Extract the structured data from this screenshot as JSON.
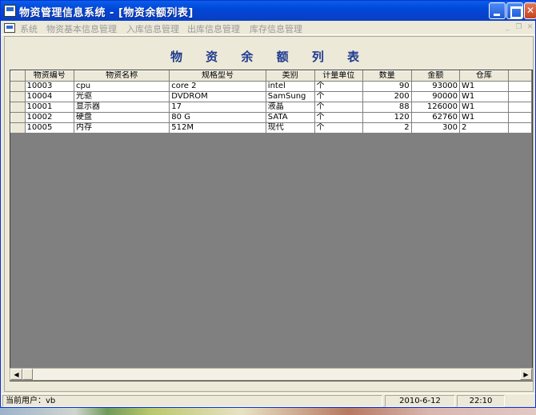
{
  "window": {
    "title": "物资管理信息系统 - [物资余额列表]"
  },
  "menu": {
    "items": [
      "系统",
      "物资基本信息管理",
      "入库信息管理",
      "出库信息管理",
      "库存信息管理"
    ]
  },
  "grid": {
    "title": "物 资 余 额 列 表",
    "columns": [
      "物资编号",
      "物资名称",
      "规格型号",
      "类别",
      "计量单位",
      "数量",
      "金额",
      "仓库"
    ],
    "rows": [
      [
        "10003",
        "cpu",
        "core 2",
        "intel",
        "个",
        "90",
        "93000",
        "W1"
      ],
      [
        "10004",
        "光驱",
        "DVDROM",
        "SamSung",
        "个",
        "200",
        "90000",
        "W1"
      ],
      [
        "10001",
        "显示器",
        "17",
        "液晶",
        "个",
        "88",
        "126000",
        "W1"
      ],
      [
        "10002",
        "硬盘",
        "80 G",
        "SATA",
        "个",
        "120",
        "62760",
        "W1"
      ],
      [
        "10005",
        "内存",
        "512M",
        "现代",
        "个",
        "2",
        "300",
        "2"
      ]
    ]
  },
  "status": {
    "user": "当前用户：vb",
    "date": "2010-6-12",
    "time": "22:10"
  },
  "icons": {
    "app": "app-icon",
    "minimize": "minimize-icon",
    "maximize": "maximize-icon",
    "close": "close-icon",
    "scroll_left": "arrow-left-icon",
    "scroll_right": "arrow-right-icon"
  },
  "colors": {
    "titlebar": "#0a5fe8",
    "grid_background": "#808080",
    "grid_title": "#1f3b8f",
    "close_button": "#c6401d"
  }
}
